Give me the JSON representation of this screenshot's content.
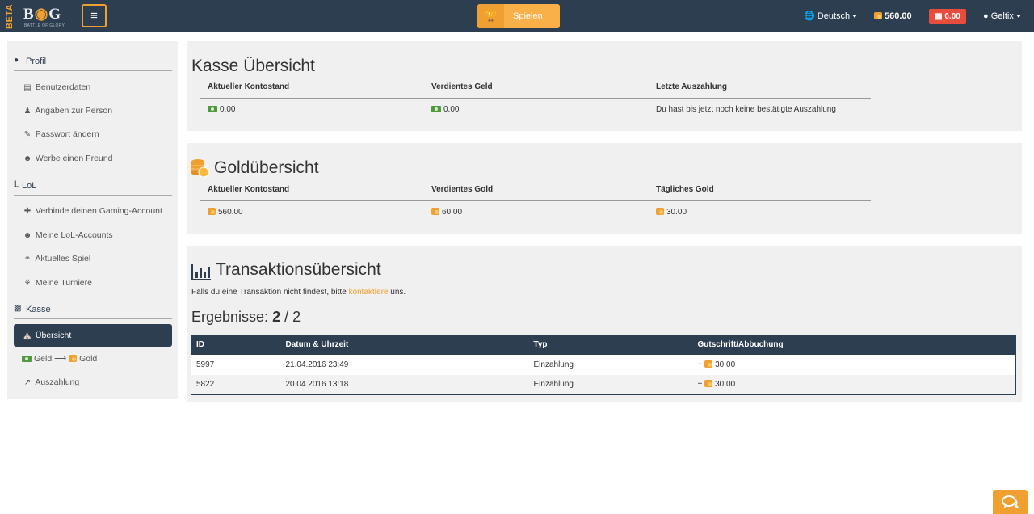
{
  "navbar": {
    "beta": "BETA",
    "logo_text_1": "B",
    "logo_text_2": "G",
    "logo_sub": "BATTLE OF GLORY",
    "menu_icon": "hamburger-icon",
    "play_label": "Spielen",
    "play_icon": "trophy-icon",
    "language": "Deutsch",
    "gold_balance": "560.00",
    "money_balance": "0.00",
    "username": "Geltix"
  },
  "sidebar": {
    "profile_label": "Profil",
    "profile_items": [
      {
        "label": "Benutzerdaten",
        "icon": "list-icon"
      },
      {
        "label": "Angaben zur Person",
        "icon": "person-icon"
      },
      {
        "label": "Passwort ändern",
        "icon": "edit-icon"
      },
      {
        "label": "Werbe einen Freund",
        "icon": "users-icon"
      }
    ],
    "lol_label": "LoL",
    "lol_items": [
      {
        "label": "Verbinde deinen Gaming-Account",
        "icon": "plus-icon"
      },
      {
        "label": "Meine LoL-Accounts",
        "icon": "users-icon"
      },
      {
        "label": "Aktuelles Spiel",
        "icon": "gamepad-icon"
      },
      {
        "label": "Meine Turniere",
        "icon": "trophy-icon"
      }
    ],
    "kasse_label": "Kasse",
    "kasse_items": [
      {
        "label": "Übersicht",
        "icon": "bank-icon",
        "active": true
      },
      {
        "label_a": "Geld",
        "label_b": "Gold",
        "icon": "cash-icon"
      },
      {
        "label": "Auszahlung",
        "icon": "share-icon"
      }
    ]
  },
  "kasse": {
    "title": "Kasse Übersicht",
    "headers": [
      "Aktueller Kontostand",
      "Verdientes Geld",
      "Letzte Auszahlung"
    ],
    "balance": "0.00",
    "earned": "0.00",
    "last_payout": "Du hast bis jetzt noch keine bestätigte Auszahlung"
  },
  "gold": {
    "title": "Goldübersicht",
    "headers": [
      "Aktueller Kontostand",
      "Verdientes Gold",
      "Tägliches Gold"
    ],
    "balance": "560.00",
    "earned": "60.00",
    "daily": "30.00"
  },
  "transactions": {
    "title": "Transaktionsübersicht",
    "note_before": "Falls du eine Transaktion nicht findest, bitte",
    "note_link": "kontaktiere",
    "note_after": "uns.",
    "results_label": "Ergebnisse:",
    "results_shown": "2",
    "results_total": "/ 2",
    "columns": [
      "ID",
      "Datum & Uhrzeit",
      "Typ",
      "Gutschrift/Abbuchung"
    ],
    "rows": [
      {
        "id": "5997",
        "date": "21.04.2016 23:49",
        "type": "Einzahlung",
        "amount": "30.00",
        "sign": "+"
      },
      {
        "id": "5822",
        "date": "20.04.2016 13:18",
        "type": "Einzahlung",
        "amount": "30.00",
        "sign": "+"
      }
    ]
  },
  "colors": {
    "navbar": "#2d3e50",
    "accent": "#f0a030",
    "danger": "#e84c3d",
    "credit": "#6aa02e"
  }
}
